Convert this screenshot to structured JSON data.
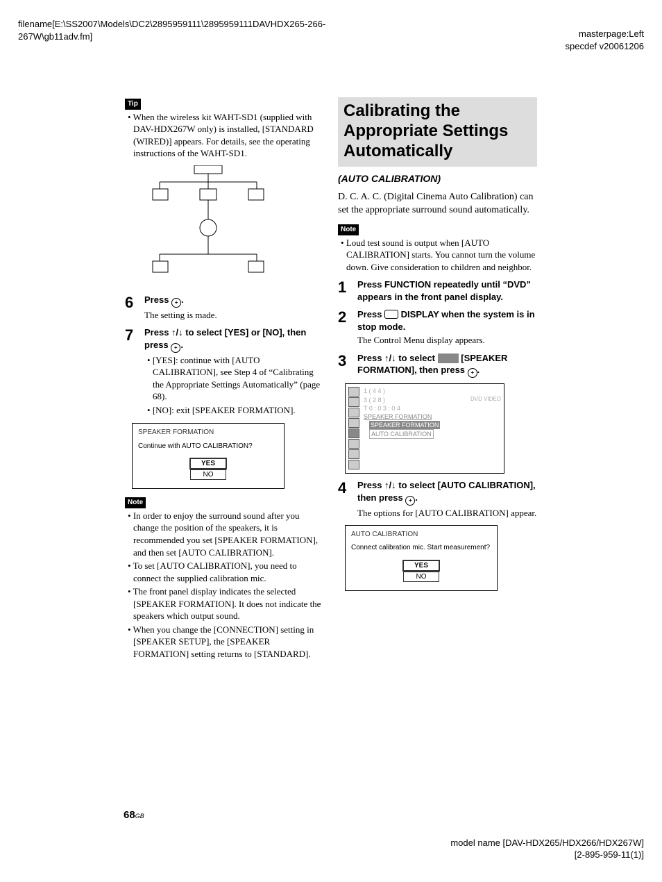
{
  "header": {
    "filename_line1": "filename[E:\\SS2007\\Models\\DC2\\2895959111\\2895959111DAVHDX265-266-",
    "filename_line2": "267W\\gb11adv.fm]",
    "masterpage": "masterpage:Left",
    "specdef": "specdef v20061206"
  },
  "left": {
    "tip_label": "Tip",
    "tip_text": "When the wireless kit WAHT-SD1 (supplied with DAV-HDX267W only) is installed, [STANDARD (WIRED)] appears. For details, see the operating instructions of the WAHT-SD1.",
    "step6_num": "6",
    "step6_bold": "Press ",
    "step6_bold_tail": ".",
    "step6_plain": "The setting is made.",
    "step7_num": "7",
    "step7_bold": "Press ↑/↓ to select [YES] or [NO], then press ",
    "step7_bold_tail": ".",
    "step7_b1": "[YES]: continue with [AUTO CALIBRATION], see Step 4 of “Calibrating the Appropriate Settings Automatically” (page 68).",
    "step7_b2": "[NO]: exit [SPEAKER FORMATION].",
    "screen7": {
      "title": "SPEAKER FORMATION",
      "prompt": "Continue with AUTO CALIBRATION?",
      "yes": "YES",
      "no": "NO"
    },
    "note_label": "Note",
    "note_b1": "In order to enjoy the surround sound after you change the position of the speakers, it is recommended you set [SPEAKER FORMATION], and then set [AUTO CALIBRATION].",
    "note_b2": "To set [AUTO CALIBRATION], you need to connect the supplied calibration mic.",
    "note_b3": "The front panel display indicates the selected [SPEAKER FORMATION]. It does not indicate the speakers which output sound.",
    "note_b4": "When you change the [CONNECTION] setting in [SPEAKER SETUP], the [SPEAKER FORMATION] setting returns to [STANDARD]."
  },
  "right": {
    "section_title": "Calibrating the Appropriate Settings Automatically",
    "section_sub": "(AUTO CALIBRATION)",
    "intro": "D. C. A. C. (Digital Cinema Auto Calibration) can set the appropriate surround sound automatically.",
    "note_label": "Note",
    "note_b1": "Loud test sound is output when [AUTO CALIBRATION] starts. You cannot turn the volume down. Give consideration to children and neighbor.",
    "step1_num": "1",
    "step1_bold": "Press FUNCTION repeatedly until “DVD” appears in the front panel display.",
    "step2_num": "2",
    "step2_bold_a": "Press ",
    "step2_bold_b": " DISPLAY when the system is in stop mode.",
    "step2_plain": "The Control Menu display appears.",
    "step3_num": "3",
    "step3_bold_a": "Press ↑/↓ to select ",
    "step3_bold_b": " [SPEAKER FORMATION], then press ",
    "step3_bold_tail": ".",
    "menu": {
      "l1": "1 ( 4 4 )",
      "l2": "3 ( 2 8 )",
      "l3": "T     0 : 0 3 : 0 4",
      "dvd": "DVD VIDEO",
      "sf1": "SPEAKER FORMATION",
      "sf2": "SPEAKER FORMATION",
      "ac": "AUTO CALIBRATION"
    },
    "step4_num": "4",
    "step4_bold": "Press ↑/↓ to select [AUTO CALIBRATION], then press ",
    "step4_bold_tail": ".",
    "step4_plain": "The options for [AUTO CALIBRATION] appear.",
    "screen4": {
      "title": "AUTO CALIBRATION",
      "prompt": "Connect calibration mic. Start measurement?",
      "yes": "YES",
      "no": "NO"
    }
  },
  "footer": {
    "page_num": "68",
    "page_gb": "GB",
    "model": "model name [DAV-HDX265/HDX266/HDX267W]",
    "code": "[2-895-959-11(1)]"
  }
}
